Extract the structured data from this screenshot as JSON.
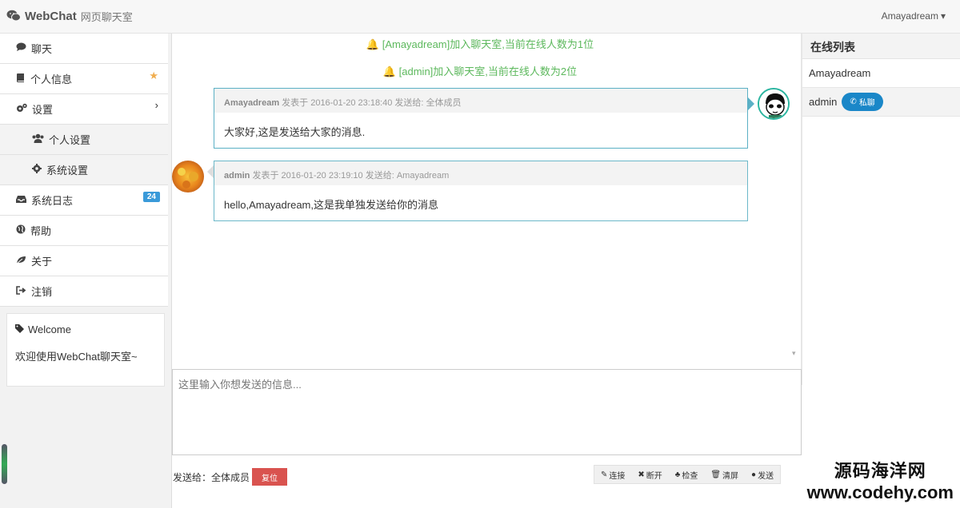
{
  "header": {
    "brand_name": "WebChat",
    "brand_sub": "网页聊天室",
    "user": "Amayadream"
  },
  "sidebar": {
    "items": [
      {
        "label": "聊天",
        "icon": "comment-icon"
      },
      {
        "label": "个人信息",
        "icon": "book-icon"
      },
      {
        "label": "设置",
        "icon": "cogs-icon"
      },
      {
        "label": "个人设置",
        "icon": "users-icon"
      },
      {
        "label": "系统设置",
        "icon": "gear-icon"
      },
      {
        "label": "系统日志",
        "icon": "inbox-icon",
        "badge": "24"
      },
      {
        "label": "帮助",
        "icon": "globe-icon"
      },
      {
        "label": "关于",
        "icon": "leaf-icon"
      },
      {
        "label": "注销",
        "icon": "sign-out-icon"
      }
    ],
    "welcome_title": "Welcome",
    "welcome_text": "欢迎使用WebChat聊天室~"
  },
  "chat": {
    "system_messages": [
      "[Amayadream]加入聊天室,当前在线人数为1位",
      "[admin]加入聊天室,当前在线人数为2位"
    ],
    "messages": [
      {
        "sender": "Amayadream",
        "meta": " 发表于 2016-01-20 23:18:40 发送给: 全体成员",
        "text": "大家好,这是发送给大家的消息."
      },
      {
        "sender": "admin",
        "meta": " 发表于 2016-01-20 23:19:10 发送给: Amayadream",
        "text": "hello,Amayadream,这是我单独发送给你的消息"
      }
    ]
  },
  "composer": {
    "placeholder": "这里输入你想发送的信息..."
  },
  "footer": {
    "send_to": "发送给：全体成员",
    "reset": "复位",
    "tools": [
      "连接",
      "断开",
      "检查",
      "清屏",
      "发送"
    ]
  },
  "online": {
    "title": "在线列表",
    "users": [
      "Amayadream",
      "admin"
    ],
    "pm_label": "私聊"
  },
  "watermark": {
    "line1": "源码海洋网",
    "line2": "www.codehy.com"
  },
  "colors": {
    "system_green": "#5cb85c",
    "message_border": "#5bb0c5",
    "badge_blue": "#3a9ad9",
    "pm_blue": "#1a87c8",
    "reset_red": "#d9534f"
  }
}
